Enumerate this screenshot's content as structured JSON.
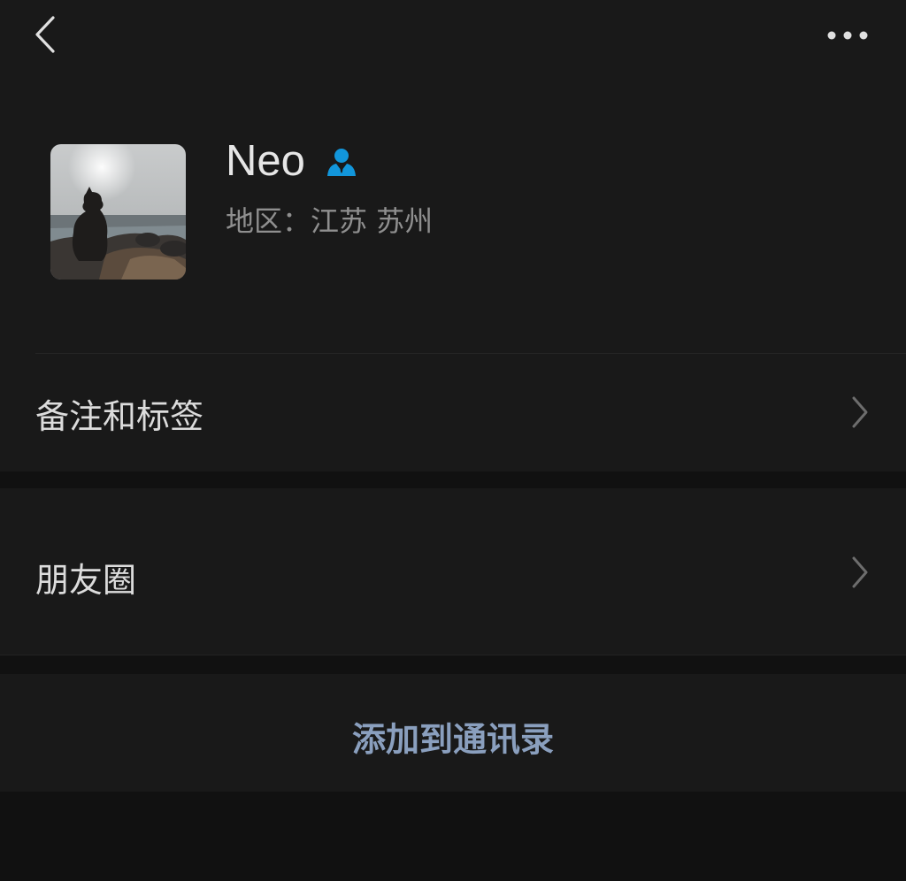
{
  "nav": {
    "back_icon": "chevron-left-icon",
    "more_icon": "more-horizontal-icon"
  },
  "profile": {
    "name": "Neo",
    "badge_icon": "contact-person-icon",
    "badge_color": "#1296db",
    "region": "地区：江苏 苏州",
    "avatar": "avatar-photo-silhouette-at-seaside"
  },
  "rows": {
    "remarks_label": "备注和标签",
    "moments_label": "朋友圈",
    "chevron_icon": "chevron-right-icon"
  },
  "actions": {
    "add_contact_label": "添加到通讯录",
    "accent_color": "#8a9fbe"
  }
}
